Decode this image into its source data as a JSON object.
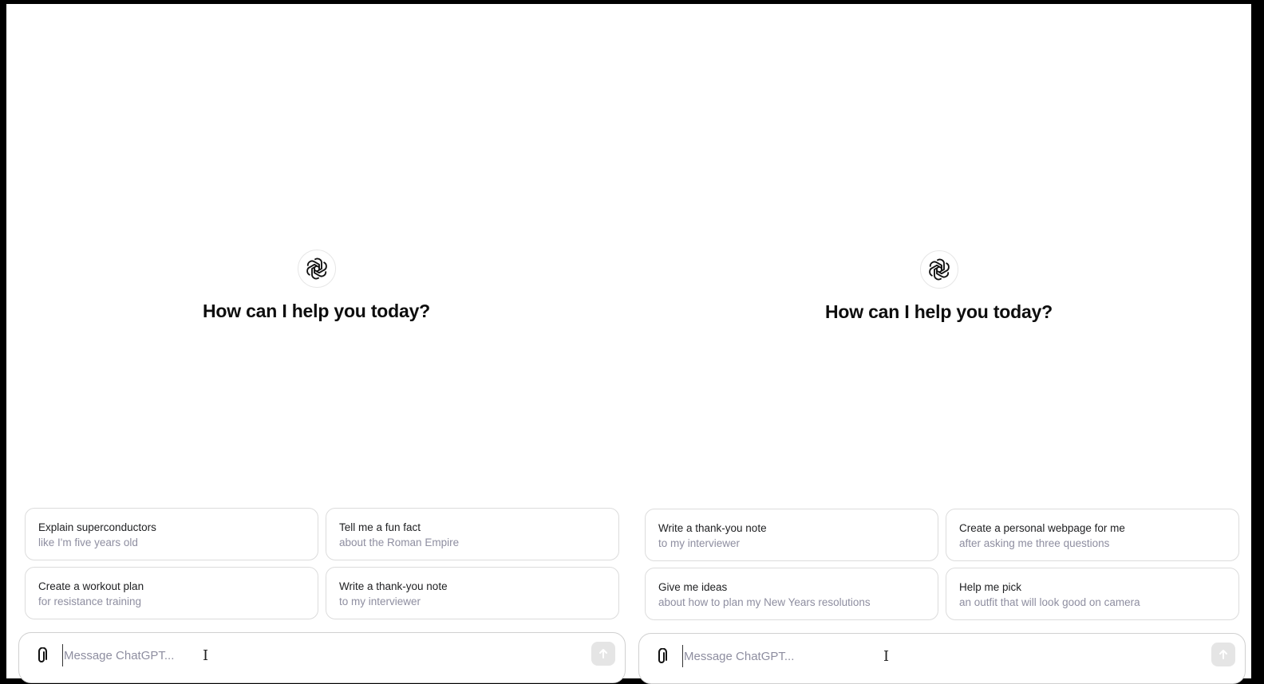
{
  "left_pane": {
    "greeting": "How can I help you today?",
    "logo_icon": "openai-logo-icon",
    "suggestions": [
      {
        "title": "Explain superconductors",
        "subtitle": "like I'm five years old"
      },
      {
        "title": "Tell me a fun fact",
        "subtitle": "about the Roman Empire"
      },
      {
        "title": "Create a workout plan",
        "subtitle": "for resistance training"
      },
      {
        "title": "Write a thank-you note",
        "subtitle": "to my interviewer"
      }
    ],
    "composer": {
      "placeholder": "Message ChatGPT...",
      "value": "",
      "attach_icon": "paperclip-icon",
      "send_icon": "arrow-up-icon"
    }
  },
  "right_pane": {
    "greeting": "How can I help you today?",
    "logo_icon": "openai-logo-icon",
    "suggestions": [
      {
        "title": "Write a thank-you note",
        "subtitle": "to my interviewer"
      },
      {
        "title": "Create a personal webpage for me",
        "subtitle": "after asking me three questions"
      },
      {
        "title": "Give me ideas",
        "subtitle": "about how to plan my New Years resolutions"
      },
      {
        "title": "Help me pick",
        "subtitle": "an outfit that will look good on camera"
      }
    ],
    "composer": {
      "placeholder": "Message ChatGPT...",
      "value": "",
      "attach_icon": "paperclip-icon",
      "send_icon": "arrow-up-icon"
    }
  }
}
